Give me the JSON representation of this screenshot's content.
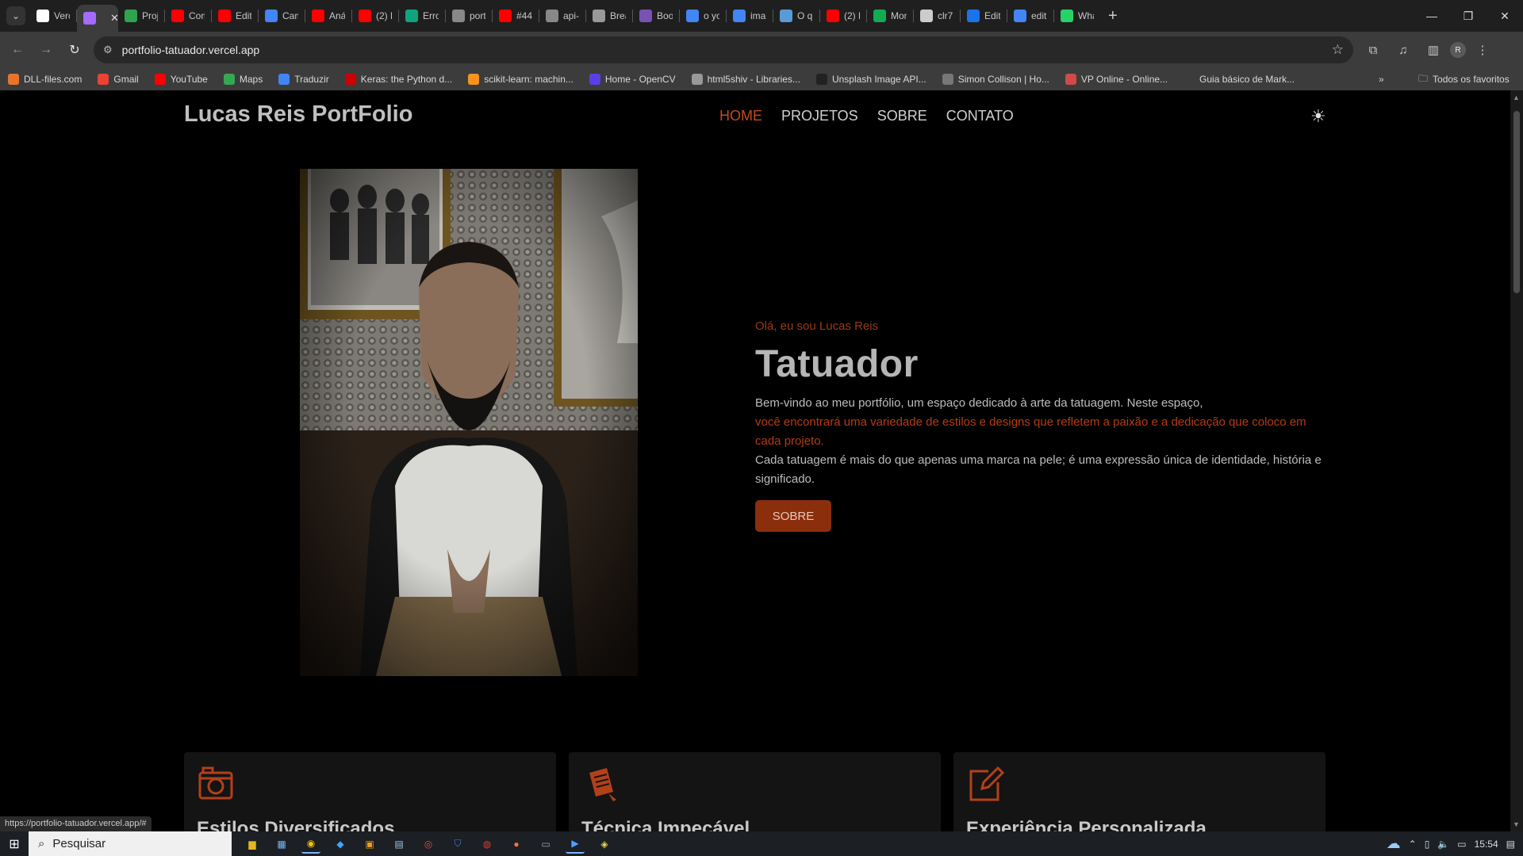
{
  "browser": {
    "tabs": [
      {
        "label": "Verc",
        "icon": "vercel-icon",
        "color": "#ffffff"
      },
      {
        "label": "I",
        "icon": "vite-icon",
        "color": "#a46bff",
        "active": true
      },
      {
        "label": "Proj",
        "icon": "project-icon",
        "color": "#2ea44f"
      },
      {
        "label": "Com",
        "icon": "youtube-icon",
        "color": "#ff0000"
      },
      {
        "label": "Edit",
        "icon": "youtube-icon",
        "color": "#ff0000"
      },
      {
        "label": "Cam",
        "icon": "drive-icon",
        "color": "#4285f4"
      },
      {
        "label": "Anál",
        "icon": "youtube-icon",
        "color": "#ff0000"
      },
      {
        "label": "(2) K",
        "icon": "youtube-icon",
        "color": "#ff0000"
      },
      {
        "label": "Erro",
        "icon": "chatgpt-icon",
        "color": "#10a37f"
      },
      {
        "label": "port",
        "icon": "github-icon",
        "color": "#888888"
      },
      {
        "label": "#44",
        "icon": "youtube-icon",
        "color": "#ff0000"
      },
      {
        "label": "api-i",
        "icon": "github-icon",
        "color": "#888888"
      },
      {
        "label": "Brea",
        "icon": "page-icon",
        "color": "#999999"
      },
      {
        "label": "Boot",
        "icon": "bootstrap-icon",
        "color": "#7952b3"
      },
      {
        "label": "o yo",
        "icon": "google-icon",
        "color": "#4285f4"
      },
      {
        "label": "imag",
        "icon": "google-icon",
        "color": "#4285f4"
      },
      {
        "label": "O qu",
        "icon": "settings-icon",
        "color": "#5b9bd5"
      },
      {
        "label": "(2) N",
        "icon": "youtube-icon",
        "color": "#ff0000"
      },
      {
        "label": "Mon",
        "icon": "mongodb-icon",
        "color": "#13aa52"
      },
      {
        "label": "clr7",
        "icon": "js-icon",
        "color": "#cccccc"
      },
      {
        "label": "Edit",
        "icon": "edit-icon",
        "color": "#1a73e8"
      },
      {
        "label": "edit",
        "icon": "google-icon",
        "color": "#4285f4"
      },
      {
        "label": "Wha",
        "icon": "whatsapp-icon",
        "color": "#25d366"
      }
    ],
    "url": "portfolio-tatuador.vercel.app",
    "bookmarks": [
      {
        "label": "DLL-files.com",
        "color": "#e8742c"
      },
      {
        "label": "Gmail",
        "color": "#ea4335"
      },
      {
        "label": "YouTube",
        "color": "#ff0000"
      },
      {
        "label": "Maps",
        "color": "#34a853"
      },
      {
        "label": "Traduzir",
        "color": "#4285f4"
      },
      {
        "label": "Keras: the Python d...",
        "color": "#d00000"
      },
      {
        "label": "scikit-learn: machin...",
        "color": "#f7931e"
      },
      {
        "label": "Home - OpenCV",
        "color": "#5c3ee8"
      },
      {
        "label": "html5shiv - Libraries...",
        "color": "#999999"
      },
      {
        "label": "Unsplash Image API...",
        "color": "#222222"
      },
      {
        "label": "Simon Collison | Ho...",
        "color": "#777777"
      },
      {
        "label": "VP Online - Online...",
        "color": "#d04a4a"
      },
      {
        "label": "Guia básico de Mark...",
        "color": "#3c3c3c"
      }
    ],
    "bookmarks_all": "Todos os favoritos",
    "profile_initial": "R",
    "status_url": "https://portfolio-tatuador.vercel.app/#"
  },
  "site": {
    "brand": "Lucas Reis PortFolio",
    "menu": [
      "HOME",
      "PROJETOS",
      "SOBRE",
      "CONTATO"
    ],
    "hero": {
      "hello": "Olá, eu sou Lucas Reis",
      "title": "Tatuador",
      "p1": "Bem-vindo ao meu portfólio, um espaço dedicado à arte da tatuagem. Neste espaço,",
      "p2": "você encontrará uma variedade de estilos e designs que refletem a paixão e a dedicação que coloco em cada projeto.",
      "p3": "Cada tatuagem é mais do que apenas uma marca na pele; é uma expressão única de identidade, história e significado.",
      "button": "SOBRE"
    },
    "cards": [
      {
        "title": "Estilos Diversificados",
        "icon": "camera-icon"
      },
      {
        "title": "Técnica Impecável",
        "icon": "notepad-icon"
      },
      {
        "title": "Experiência Personalizada",
        "icon": "edit-square-icon"
      }
    ],
    "accent_color": "#c44a20"
  },
  "taskbar": {
    "search_placeholder": "Pesquisar",
    "time": "15:54"
  }
}
